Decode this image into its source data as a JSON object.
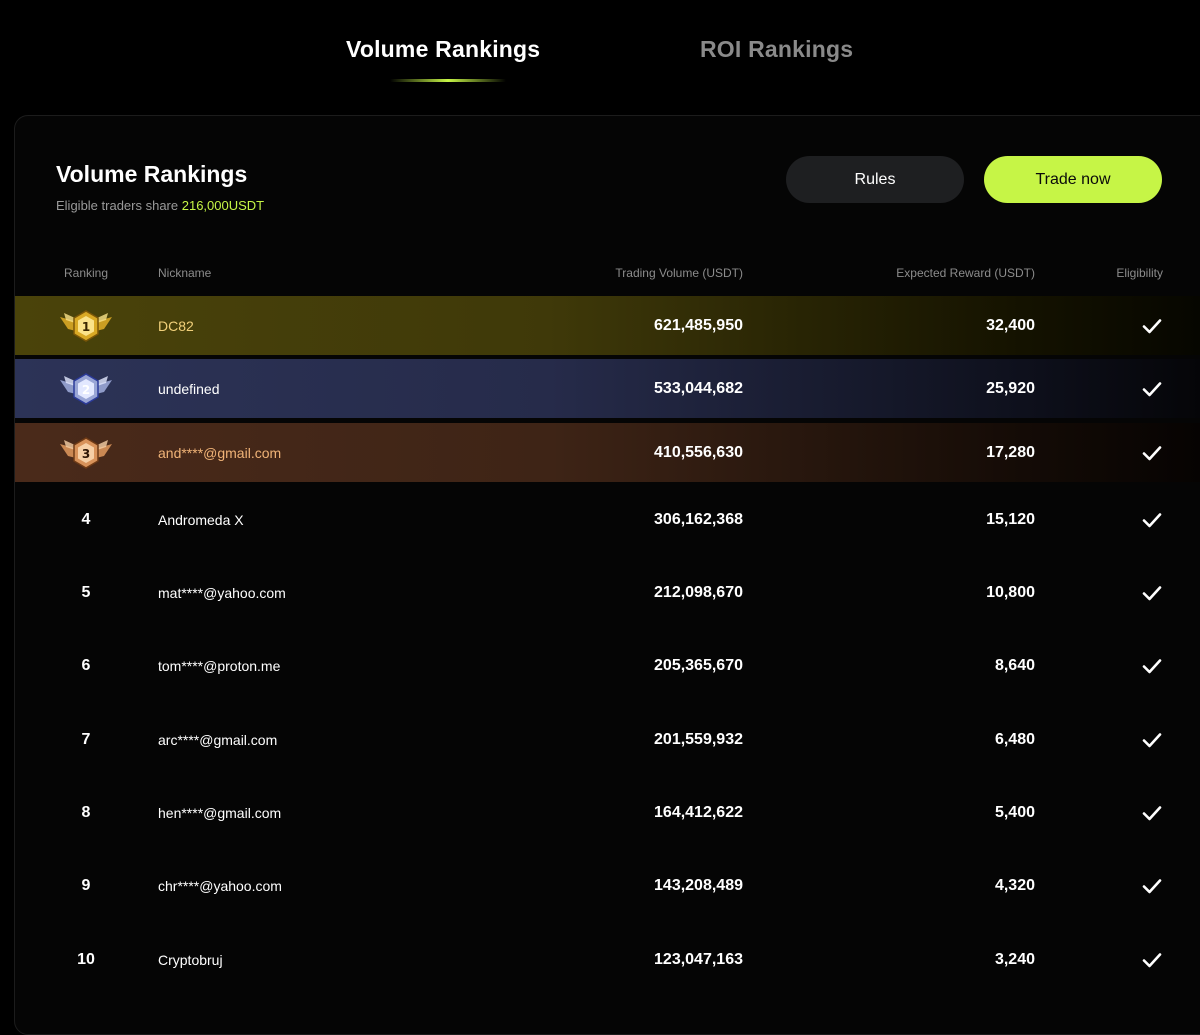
{
  "tabs": [
    {
      "label": "Volume Rankings",
      "active": true
    },
    {
      "label": "ROI Rankings",
      "active": false
    }
  ],
  "panel": {
    "title": "Volume Rankings",
    "subtitle_prefix": "Eligible traders share ",
    "pool_amount": "216,000USDT",
    "rules_label": "Rules",
    "trade_label": "Trade now"
  },
  "columns": {
    "ranking": "Ranking",
    "nickname": "Nickname",
    "volume": "Trading Volume (USDT)",
    "reward": "Expected Reward (USDT)",
    "eligibility": "Eligibility"
  },
  "rows": [
    {
      "rank": "1",
      "nickname": "DC82",
      "volume": "621,485,950",
      "reward": "32,400",
      "eligible": true
    },
    {
      "rank": "2",
      "nickname": "undefined",
      "volume": "533,044,682",
      "reward": "25,920",
      "eligible": true
    },
    {
      "rank": "3",
      "nickname": "and****@gmail.com",
      "volume": "410,556,630",
      "reward": "17,280",
      "eligible": true
    },
    {
      "rank": "4",
      "nickname": "Andromeda X",
      "volume": "306,162,368",
      "reward": "15,120",
      "eligible": true
    },
    {
      "rank": "5",
      "nickname": "mat****@yahoo.com",
      "volume": "212,098,670",
      "reward": "10,800",
      "eligible": true
    },
    {
      "rank": "6",
      "nickname": "tom****@proton.me",
      "volume": "205,365,670",
      "reward": "8,640",
      "eligible": true
    },
    {
      "rank": "7",
      "nickname": "arc****@gmail.com",
      "volume": "201,559,932",
      "reward": "6,480",
      "eligible": true
    },
    {
      "rank": "8",
      "nickname": "hen****@gmail.com",
      "volume": "164,412,622",
      "reward": "5,400",
      "eligible": true
    },
    {
      "rank": "9",
      "nickname": "chr****@yahoo.com",
      "volume": "143,208,489",
      "reward": "4,320",
      "eligible": true
    },
    {
      "rank": "10",
      "nickname": "Cryptobruj",
      "volume": "123,047,163",
      "reward": "3,240",
      "eligible": true
    }
  ],
  "colors": {
    "accent": "#c6f546",
    "gold_text": "#f1d07a",
    "bronze_text": "#f0b377",
    "muted": "#8c8c8c"
  },
  "icons": {
    "eligibility": "check-icon",
    "rank_1": "gold-medal-icon",
    "rank_2": "silver-medal-icon",
    "rank_3": "bronze-medal-icon"
  }
}
